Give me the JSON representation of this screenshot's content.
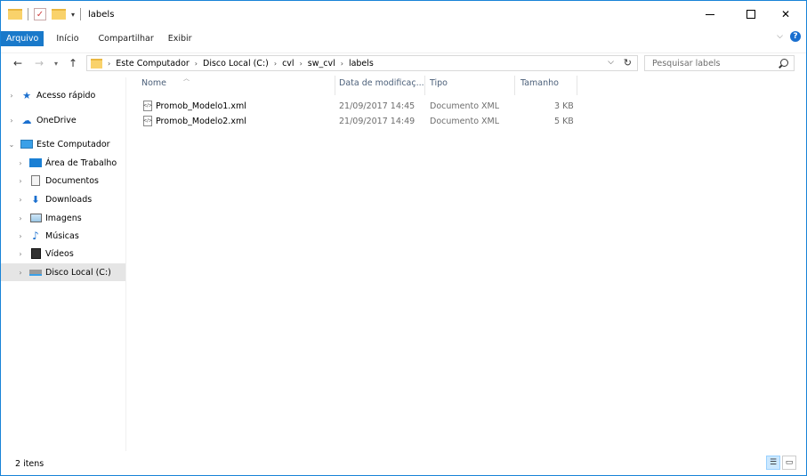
{
  "window": {
    "title": "labels"
  },
  "ribbon": {
    "tabs": [
      "Arquivo",
      "Início",
      "Compartilhar",
      "Exibir"
    ]
  },
  "address": {
    "crumbs": [
      "Este Computador",
      "Disco Local (C:)",
      "cvl",
      "sw_cvl",
      "labels"
    ]
  },
  "search": {
    "placeholder": "Pesquisar labels"
  },
  "nav": {
    "items": [
      {
        "label": "Acesso rápido",
        "icon": "star-icon"
      },
      {
        "label": "OneDrive",
        "icon": "cloud-icon"
      },
      {
        "label": "Este Computador",
        "icon": "computer-icon"
      },
      {
        "label": "Área de Trabalho",
        "icon": "desktop-icon"
      },
      {
        "label": "Documentos",
        "icon": "document-icon"
      },
      {
        "label": "Downloads",
        "icon": "download-icon"
      },
      {
        "label": "Imagens",
        "icon": "image-icon"
      },
      {
        "label": "Músicas",
        "icon": "music-icon"
      },
      {
        "label": "Vídeos",
        "icon": "video-icon"
      },
      {
        "label": "Disco Local (C:)",
        "icon": "drive-icon"
      }
    ]
  },
  "columns": {
    "name": "Nome",
    "date": "Data de modificaç...",
    "type": "Tipo",
    "size": "Tamanho"
  },
  "files": [
    {
      "name": "Promob_Modelo1.xml",
      "date": "21/09/2017 14:45",
      "type": "Documento XML",
      "size": "3 KB"
    },
    {
      "name": "Promob_Modelo2.xml",
      "date": "21/09/2017 14:49",
      "type": "Documento XML",
      "size": "5 KB"
    }
  ],
  "status": {
    "count": "2 itens"
  },
  "colors": {
    "accent": "#1979ca",
    "selected_nav": "#e5e5e5",
    "header_text": "#4c607a"
  }
}
